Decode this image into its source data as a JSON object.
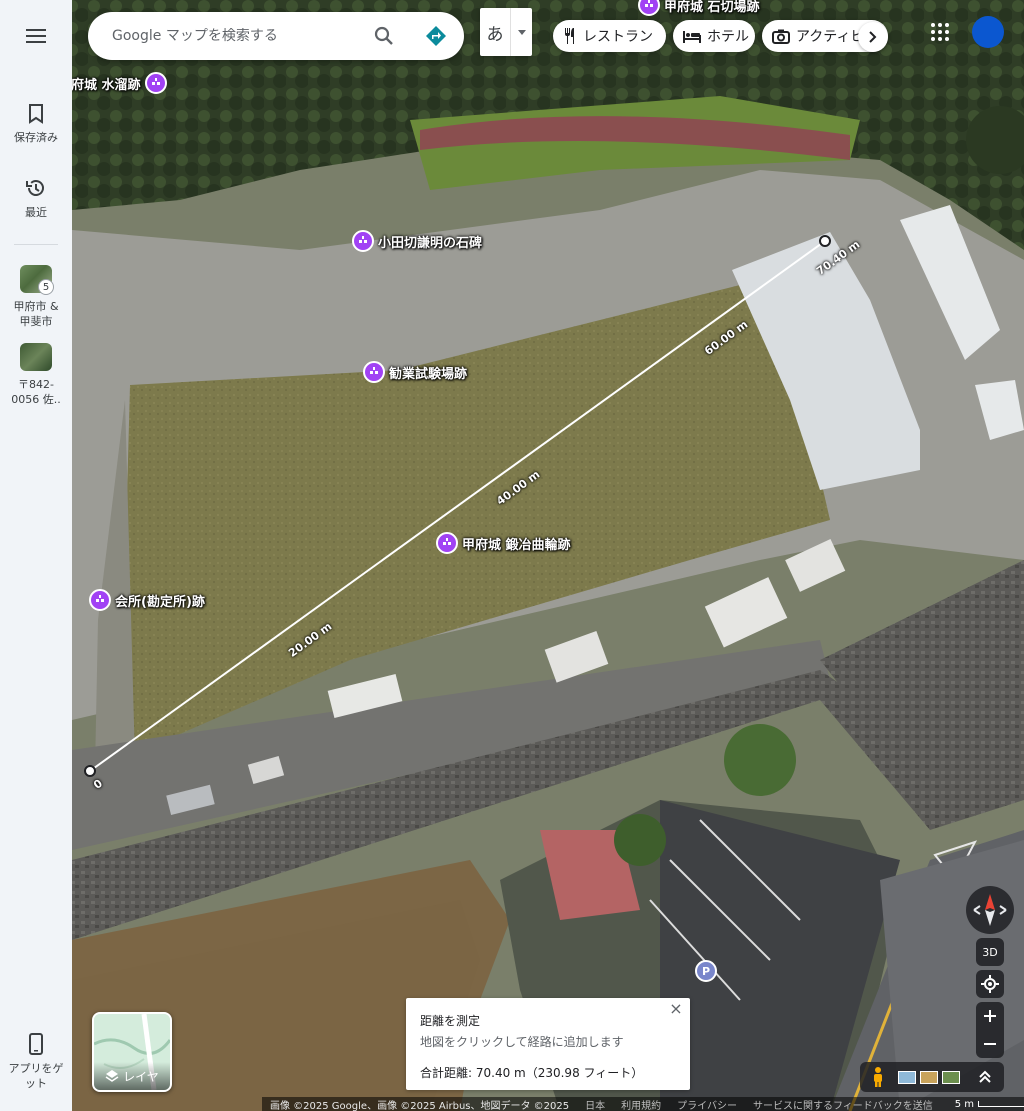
{
  "rail": {
    "saved_label": "保存済み",
    "recent_label": "最近",
    "recent_items": [
      {
        "label": "甲府市 & 甲斐市",
        "badge": "5"
      },
      {
        "label": "〒842-0056 佐.."
      }
    ],
    "get_app_label": "アプリをゲット"
  },
  "search": {
    "placeholder": "Google マップを検索する"
  },
  "ime": {
    "label": "あ"
  },
  "chips": [
    {
      "label": "レストラン"
    },
    {
      "label": "ホテル"
    },
    {
      "label": "アクティビ"
    }
  ],
  "pois": [
    {
      "label": "甲府城 石切場跡"
    },
    {
      "label": "甲府城 水溜跡"
    },
    {
      "label": "小田切謙明の石碑"
    },
    {
      "label": "勧業試験場跡"
    },
    {
      "label": "甲府城 鍛冶曲輪跡"
    },
    {
      "label": "会所(勘定所)跡"
    }
  ],
  "measure": {
    "labels": [
      "0",
      "20.00 m",
      "40.00 m",
      "60.00 m",
      "70.40 m"
    ],
    "card_title": "距離を測定",
    "card_hint": "地図をクリックして経路に追加します",
    "card_total": "合計距離: 70.40 m（230.98 フィート）"
  },
  "layers": {
    "label": "レイヤ"
  },
  "controls": {
    "three_d": "3D"
  },
  "parking": "P",
  "attribution": {
    "imagery": "画像 ©2025 Google、画像 ©2025 Airbus、地図データ ©2025",
    "links": [
      "日本",
      "利用規約",
      "プライバシー",
      "サービスに関するフィードバックを送信"
    ],
    "scale": "5 m"
  }
}
